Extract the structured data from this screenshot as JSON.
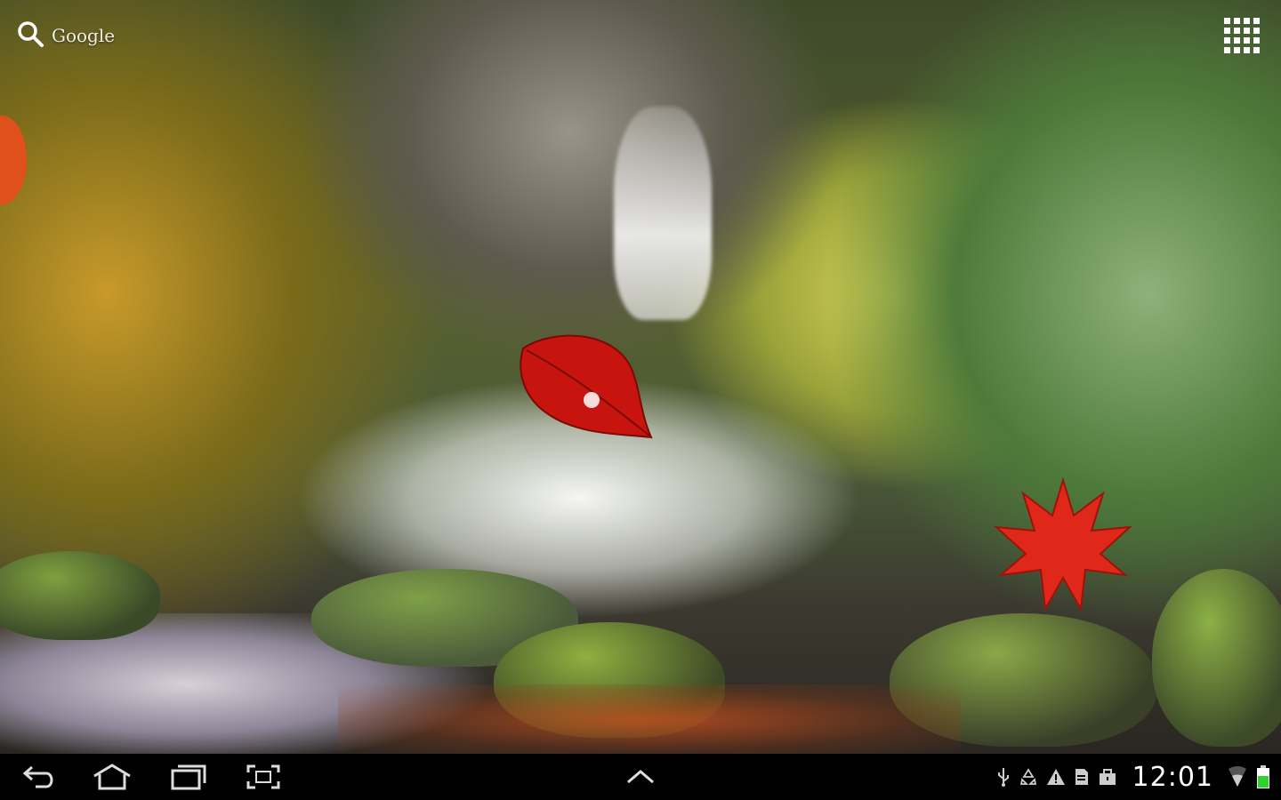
{
  "home": {
    "search_label": "Google",
    "search_icon": "search-icon",
    "apps_icon": "all-apps-grid-icon"
  },
  "wallpaper": {
    "description_icons": [
      "red-leaf",
      "maple-leaf"
    ],
    "colors": {
      "leaf_red": "#c8140f",
      "maple_red": "#e0281a"
    }
  },
  "navbar": {
    "buttons": [
      "back-icon",
      "home-icon",
      "recent-apps-icon",
      "screenshot-icon"
    ],
    "center_icon": "chevron-up-icon"
  },
  "status": {
    "time": "12:01",
    "icons": [
      "usb-icon",
      "recycle-icon",
      "warning-icon",
      "sd-card-icon",
      "briefcase-icon",
      "wifi-icon",
      "battery-icon"
    ],
    "battery_level": 0.6,
    "battery_color": "#2ed12e"
  }
}
